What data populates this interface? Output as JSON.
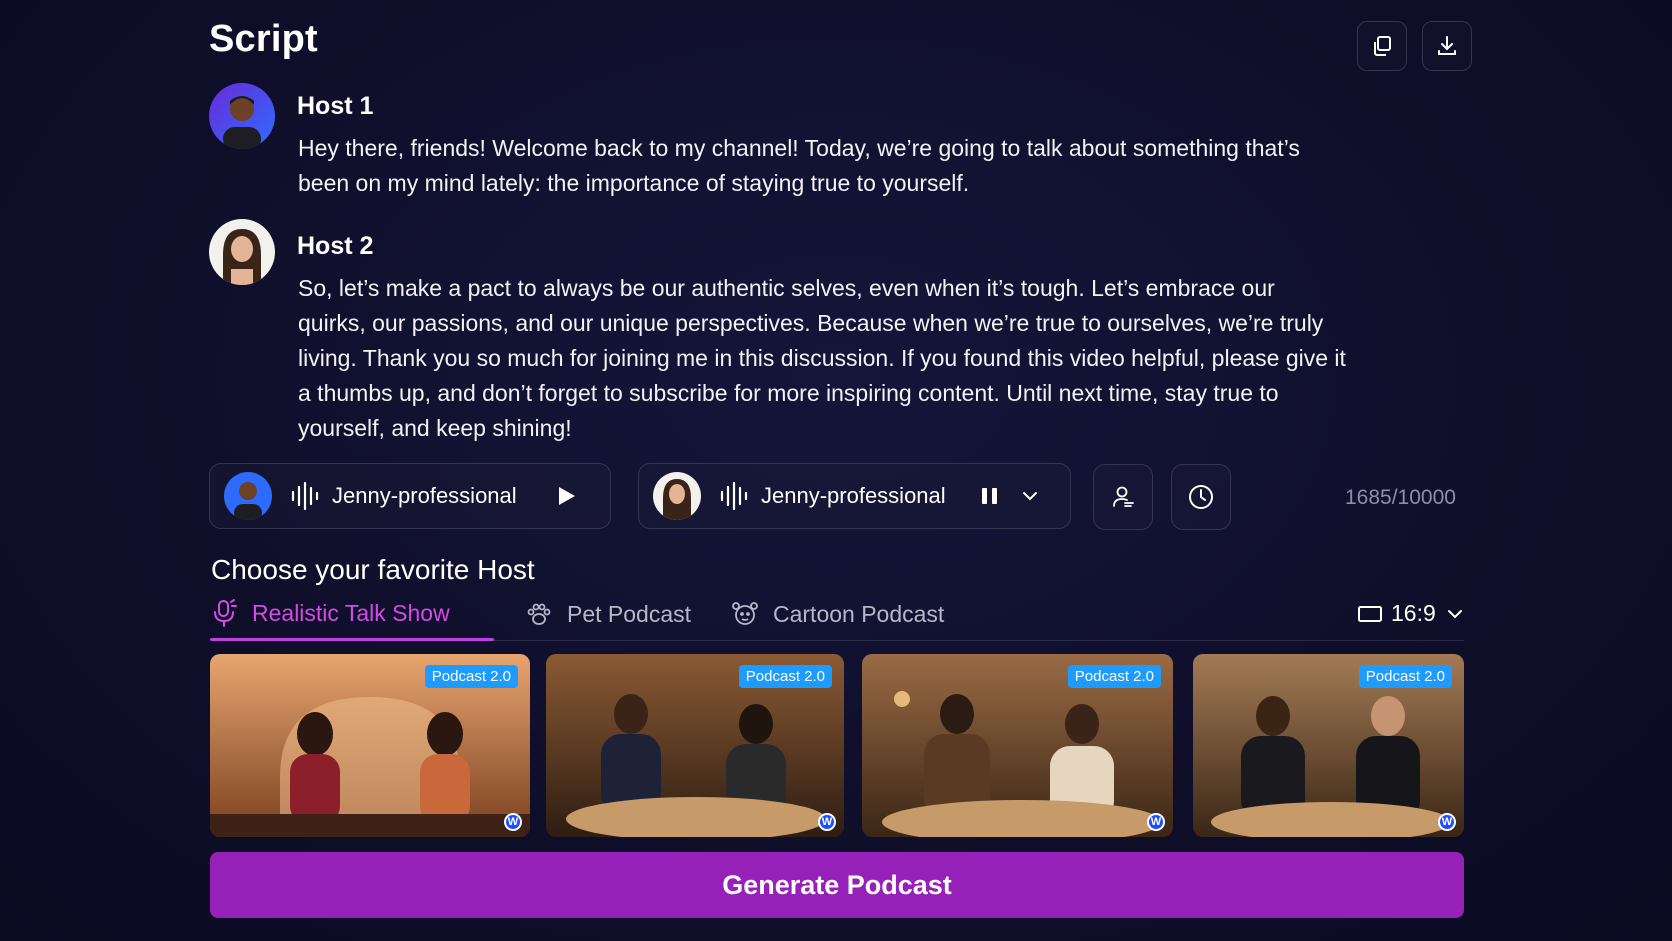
{
  "header": {
    "title": "Script"
  },
  "top_actions": {
    "copy_icon": "copy-icon",
    "download_icon": "download-icon"
  },
  "hosts": [
    {
      "name": "Host 1",
      "text": "Hey there, friends! Welcome back to my channel! Today, we’re going to talk about something that’s been on my mind lately: the importance of staying true to yourself."
    },
    {
      "name": "Host 2",
      "text": "So, let’s make a pact to always be our authentic selves, even when it’s tough. Let’s embrace our quirks, our passions, and our unique perspectives. Because when we’re true to ourselves, we’re truly living. Thank you so much for joining me in this discussion. If you found this video helpful, please give it a thumbs up, and don’t forget to subscribe for more inspiring content. Until next time, stay true to yourself, and keep shining!"
    }
  ],
  "voices": [
    {
      "name": "Jenny-professional",
      "state": "play"
    },
    {
      "name": "Jenny-professional",
      "state": "pause"
    }
  ],
  "char_count": "1685/10000",
  "chooser": {
    "title": "Choose your favorite Host",
    "tabs": [
      {
        "label": "Realistic Talk Show",
        "icon": "mic-icon",
        "active": true
      },
      {
        "label": "Pet Podcast",
        "icon": "paw-icon",
        "active": false
      },
      {
        "label": "Cartoon Podcast",
        "icon": "cartoon-icon",
        "active": false
      }
    ],
    "aspect_ratio": "16:9",
    "thumbnails": [
      {
        "badge": "Podcast 2.0"
      },
      {
        "badge": "Podcast 2.0"
      },
      {
        "badge": "Podcast 2.0"
      },
      {
        "badge": "Podcast 2.0"
      }
    ]
  },
  "generate_button": "Generate Podcast",
  "colors": {
    "accent": "#9521b8",
    "active_tab": "#d24ce6",
    "badge": "#1e9bff",
    "background": "#11112e"
  }
}
